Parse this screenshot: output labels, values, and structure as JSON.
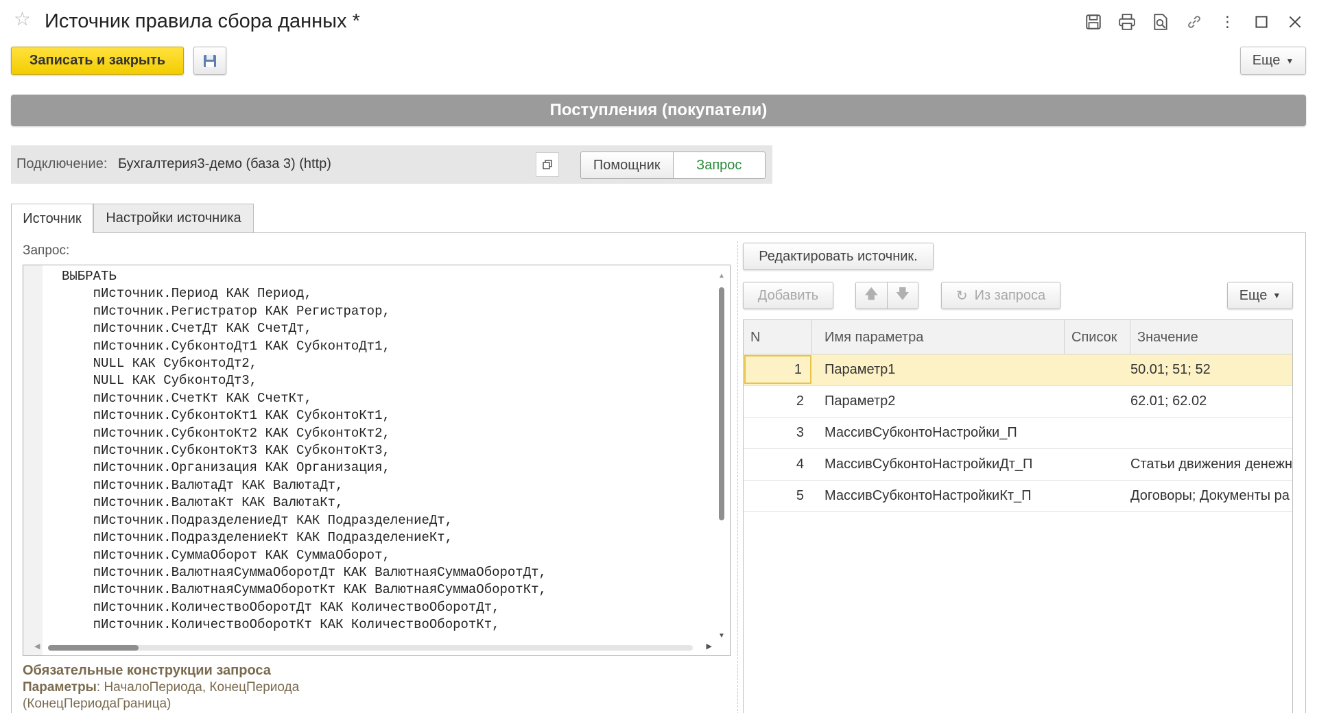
{
  "window": {
    "title": "Источник правила сбора данных *",
    "icons": [
      "star-icon",
      "save-doc-icon",
      "print-icon",
      "preview-icon",
      "link-icon",
      "kebab-icon",
      "maximize-icon",
      "close-icon"
    ]
  },
  "toolbar": {
    "save_close_label": "Записать и закрыть",
    "more_label": "Еще"
  },
  "banner": {
    "title": "Поступления (покупатели)"
  },
  "connection": {
    "label": "Подключение:",
    "value": "Бухгалтерия3-демо (база 3) (http)",
    "mode_assistant": "Помощник",
    "mode_query": "Запрос"
  },
  "tabs": [
    {
      "label": "Источник",
      "active": true
    },
    {
      "label": "Настройки источника",
      "active": false
    }
  ],
  "query": {
    "label": "Запрос:",
    "lines": [
      "ВЫБРАТЬ",
      "    пИсточник.Период КАК Период,",
      "    пИсточник.Регистратор КАК Регистратор,",
      "    пИсточник.СчетДт КАК СчетДт,",
      "    пИсточник.СубконтоДт1 КАК СубконтоДт1,",
      "    NULL КАК СубконтоДт2,",
      "    NULL КАК СубконтоДт3,",
      "    пИсточник.СчетКт КАК СчетКт,",
      "    пИсточник.СубконтоКт1 КАК СубконтоКт1,",
      "    пИсточник.СубконтоКт2 КАК СубконтоКт2,",
      "    пИсточник.СубконтоКт3 КАК СубконтоКт3,",
      "    пИсточник.Организация КАК Организация,",
      "    пИсточник.ВалютаДт КАК ВалютаДт,",
      "    пИсточник.ВалютаКт КАК ВалютаКт,",
      "    пИсточник.ПодразделениеДт КАК ПодразделениеДт,",
      "    пИсточник.ПодразделениеКт КАК ПодразделениеКт,",
      "    пИсточник.СуммаОборот КАК СуммаОборот,",
      "    пИсточник.ВалютнаяСуммаОборотДт КАК ВалютнаяСуммаОборотДт,",
      "    пИсточник.ВалютнаяСуммаОборотКт КАК ВалютнаяСуммаОборотКт,",
      "    пИсточник.КоличествоОборотДт КАК КоличествоОборотДт,",
      "    пИсточник.КоличествоОборотКт КАК КоличествоОборотКт,"
    ]
  },
  "required": {
    "title": "Обязательные конструкции запроса",
    "params_label": "Параметры",
    "params_value": ": НачалоПериода, КонецПериода (КонецПериодаГраница)"
  },
  "params_panel": {
    "edit_source_label": "Редактировать источник.",
    "add_label": "Добавить",
    "from_query_label": "Из запроса",
    "more_label": "Еще",
    "columns": {
      "n": "N",
      "name": "Имя параметра",
      "list": "Список",
      "value": "Значение"
    },
    "rows": [
      {
        "n": "1",
        "name": "Параметр1",
        "value": "50.01; 51; 52",
        "selected": true
      },
      {
        "n": "2",
        "name": "Параметр2",
        "value": "62.01; 62.02",
        "selected": false
      },
      {
        "n": "3",
        "name": "МассивСубконтоНастройки_П",
        "value": "",
        "selected": false
      },
      {
        "n": "4",
        "name": "МассивСубконтоНастройкиДт_П",
        "value": "Статьи движения денежн",
        "selected": false
      },
      {
        "n": "5",
        "name": "МассивСубконтоНастройкиКт_П",
        "value": "Договоры; Документы ра",
        "selected": false
      }
    ]
  }
}
